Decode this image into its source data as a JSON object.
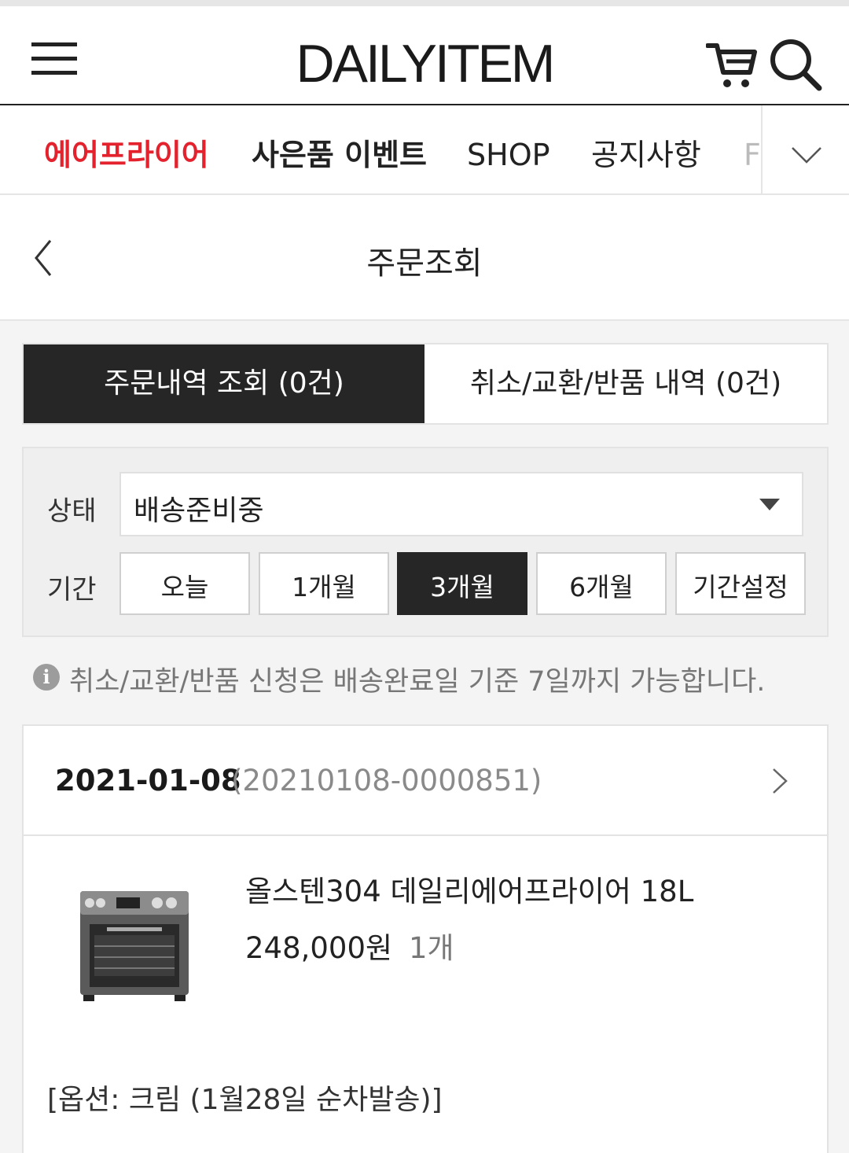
{
  "header": {
    "logo": "DAILYITEM",
    "menu_icon": "hamburger-menu-icon",
    "cart_icon": "cart-icon",
    "search_icon": "search-icon"
  },
  "nav": {
    "items": [
      {
        "label": "에어프라이어"
      },
      {
        "label": "사은품 이벤트"
      },
      {
        "label": "SHOP"
      },
      {
        "label": "공지사항"
      },
      {
        "label": "F"
      }
    ],
    "more_icon": "chevron-down-icon"
  },
  "page": {
    "title": "주문조회",
    "back_icon": "chevron-left-icon"
  },
  "tabs": [
    {
      "label": "주문내역 조회 (0건)",
      "active": true
    },
    {
      "label": "취소/교환/반품 내역 (0건)",
      "active": false
    }
  ],
  "filter": {
    "status_label": "상태",
    "status_value": "배송준비중",
    "period_label": "기간",
    "periods": [
      "오늘",
      "1개월",
      "3개월",
      "6개월",
      "기간설정"
    ],
    "selected_period": "3개월"
  },
  "notice": {
    "icon": "info-icon",
    "text": "취소/교환/반품 신청은 배송완료일 기준 7일까지 가능합니다."
  },
  "order": {
    "date": "2021-01-08",
    "number": "(20210108-0000851)",
    "product_name": "올스텐304 데일리에어프라이어 18L",
    "price": "248,000원",
    "quantity": "1개",
    "option": "[옵션: 크림 (1월28일 순차발송)]"
  },
  "colors": {
    "accent_red": "#e4222e",
    "dark": "#262626",
    "background": "#f4f4f4"
  }
}
